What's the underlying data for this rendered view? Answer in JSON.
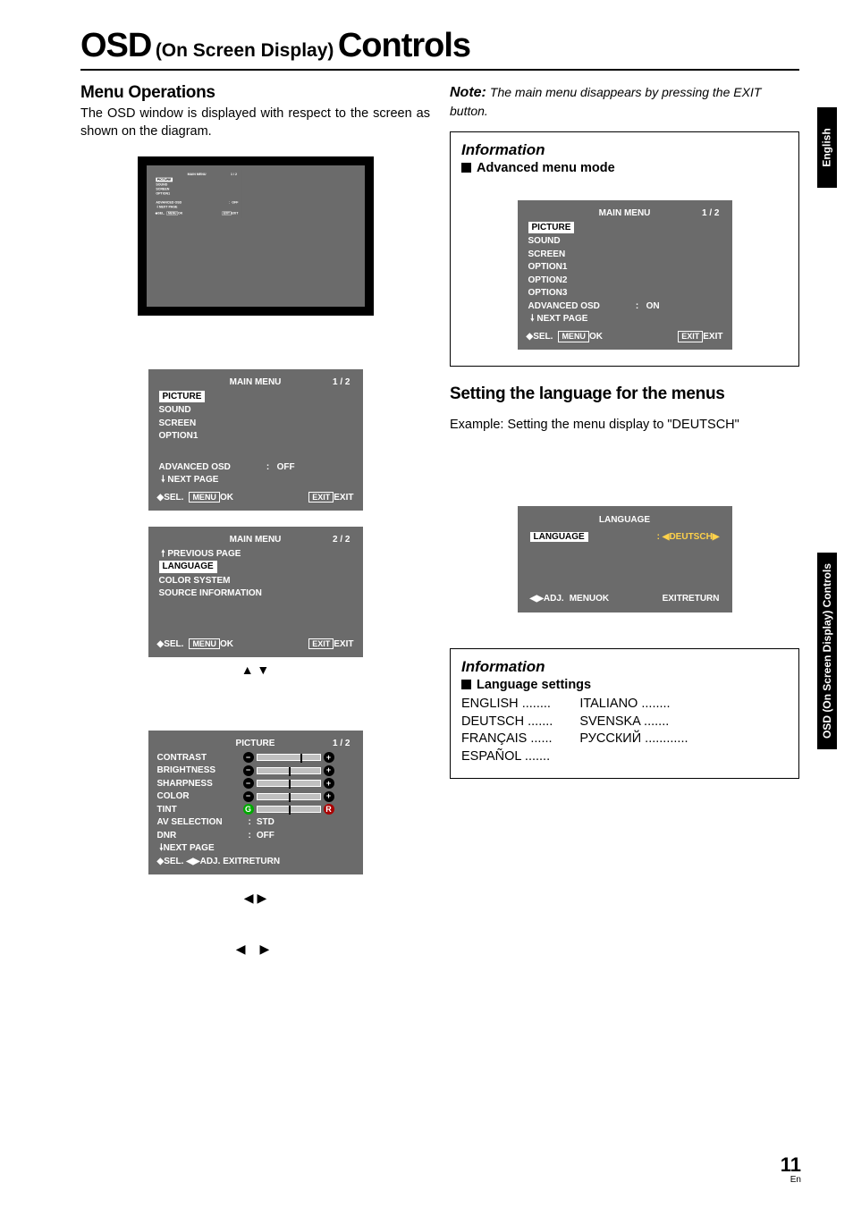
{
  "page_number": "11",
  "page_lang_suffix": "En",
  "side_tab_1": "English",
  "side_tab_2": "OSD (On Screen Display) Controls",
  "title": {
    "main_a": "OSD",
    "sub": "(On Screen Display)",
    "main_b": "Controls"
  },
  "left": {
    "section_heading": "Menu Operations",
    "intro": "The OSD window is displayed with respect to the screen as shown on the diagram.",
    "osd_basic": {
      "title": "MAIN MENU",
      "page": "1 / 2",
      "items": [
        "PICTURE",
        "SOUND",
        "SCREEN",
        "OPTION1"
      ],
      "adv_label": "ADVANCED OSD",
      "adv_val": "OFF",
      "next_page": "NEXT PAGE",
      "footer_sel": "SEL.",
      "footer_menu": "MENU",
      "footer_ok": "OK",
      "footer_exit_btn": "EXIT",
      "footer_exit": "EXIT"
    },
    "osd_page2": {
      "title": "MAIN MENU",
      "page": "2 / 2",
      "prev_page": "PREVIOUS PAGE",
      "items": [
        "LANGUAGE",
        "COLOR SYSTEM",
        "SOURCE INFORMATION"
      ],
      "footer_sel": "SEL.",
      "footer_menu": "MENU",
      "footer_ok": "OK",
      "footer_exit_btn": "EXIT",
      "footer_exit": "EXIT"
    },
    "arrows_ud": "▲ ▼",
    "picture_osd": {
      "title": "PICTURE",
      "page": "1 / 2",
      "rows": [
        {
          "label": "CONTRAST"
        },
        {
          "label": "BRIGHTNESS"
        },
        {
          "label": "SHARPNESS"
        },
        {
          "label": "COLOR"
        },
        {
          "label": "TINT"
        }
      ],
      "av_sel_label": "AV SELECTION",
      "av_sel_val": "STD",
      "dnr_label": "DNR",
      "dnr_val": "OFF",
      "next_page": "NEXT PAGE",
      "footer_sel": "SEL.",
      "footer_adj": "ADJ.",
      "footer_exit_btn": "EXIT",
      "footer_return": "RETURN"
    },
    "arrows_lr": "◀ ▶",
    "arrows_lr_spaced": "◀     ▶"
  },
  "right": {
    "note_label": "Note:",
    "note_text": "The main menu disappears by pressing the EXIT button.",
    "info1_title": "Information",
    "info1_sub": "Advanced menu mode",
    "osd_adv": {
      "title": "MAIN MENU",
      "page": "1 / 2",
      "items": [
        "PICTURE",
        "SOUND",
        "SCREEN",
        "OPTION1",
        "OPTION2",
        "OPTION3"
      ],
      "adv_label": "ADVANCED OSD",
      "adv_val": "ON",
      "next_page": "NEXT PAGE",
      "footer_sel": "SEL.",
      "footer_menu": "MENU",
      "footer_ok": "OK",
      "footer_exit_btn": "EXIT",
      "footer_exit": "EXIT"
    },
    "section2_heading": "Setting the language for the menus",
    "section2_example": "Example: Setting the menu display to \"DEUTSCH\"",
    "lang_osd": {
      "title": "LANGUAGE",
      "row_label": "LANGUAGE",
      "value": "DEUTSCH",
      "footer_adj": "ADJ.",
      "footer_menu": "MENU",
      "footer_ok": "OK",
      "footer_exit_btn": "EXIT",
      "footer_return": "RETURN"
    },
    "info2_title": "Information",
    "info2_sub": "Language settings",
    "lang_list_col1": [
      "ENGLISH",
      "DEUTSCH",
      "FRANÇAIS",
      "ESPAÑOL"
    ],
    "lang_list_col2": [
      "ITALIANO",
      "SVENSKA",
      "РУССКИЙ"
    ]
  }
}
